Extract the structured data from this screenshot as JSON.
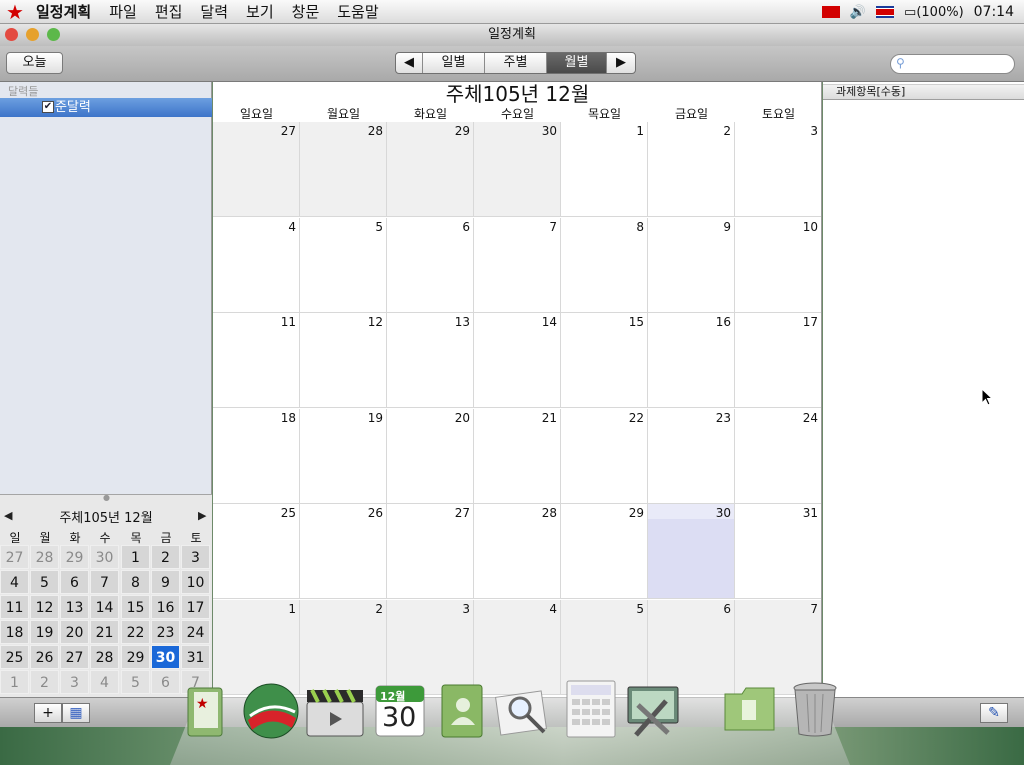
{
  "menubar": {
    "app_name": "일정계획",
    "items": [
      "파일",
      "편집",
      "달력",
      "보기",
      "창문",
      "도움말"
    ],
    "battery": "(100%)",
    "clock": "07:14"
  },
  "window": {
    "title": "일정계획"
  },
  "toolbar": {
    "today_label": "오늘",
    "views": [
      "일별",
      "주별",
      "월별"
    ],
    "active_view": "월별",
    "search_value": ""
  },
  "sidebar": {
    "heading": "달력들",
    "calendars": [
      {
        "label": "표준달력",
        "checked": true
      }
    ]
  },
  "mini_calendar": {
    "title": "주체105년 12월",
    "weekdays": [
      "일",
      "월",
      "화",
      "수",
      "목",
      "금",
      "토"
    ],
    "weeks": [
      [
        "27",
        "28",
        "29",
        "30",
        "1",
        "2",
        "3"
      ],
      [
        "4",
        "5",
        "6",
        "7",
        "8",
        "9",
        "10"
      ],
      [
        "11",
        "12",
        "13",
        "14",
        "15",
        "16",
        "17"
      ],
      [
        "18",
        "19",
        "20",
        "21",
        "22",
        "23",
        "24"
      ],
      [
        "25",
        "26",
        "27",
        "28",
        "29",
        "30",
        "31"
      ],
      [
        "1",
        "2",
        "3",
        "4",
        "5",
        "6",
        "7"
      ]
    ],
    "selected": "30"
  },
  "month_view": {
    "title": "주체105년 12월",
    "weekdays": [
      "일요일",
      "월요일",
      "화요일",
      "수요일",
      "목요일",
      "금요일",
      "토요일"
    ],
    "weeks": [
      [
        "27",
        "28",
        "29",
        "30",
        "1",
        "2",
        "3"
      ],
      [
        "4",
        "5",
        "6",
        "7",
        "8",
        "9",
        "10"
      ],
      [
        "11",
        "12",
        "13",
        "14",
        "15",
        "16",
        "17"
      ],
      [
        "18",
        "19",
        "20",
        "21",
        "22",
        "23",
        "24"
      ],
      [
        "25",
        "26",
        "27",
        "28",
        "29",
        "30",
        "31"
      ],
      [
        "1",
        "2",
        "3",
        "4",
        "5",
        "6",
        "7"
      ]
    ],
    "today": "30"
  },
  "tasks": {
    "header": "과제항목[수동]"
  },
  "dock": {
    "calendar_icon_month": "12월",
    "calendar_icon_day": "30",
    "items": [
      "notes-app-icon",
      "browser-globe-icon",
      "video-clapper-icon",
      "calendar-app-icon",
      "address-book-icon",
      "preview-magnifier-icon",
      "calculator-icon",
      "system-preferences-icon",
      "documents-folder-icon",
      "trash-icon"
    ]
  },
  "colors": {
    "selection": "#1a68d8",
    "today_cell": "#dcddf3",
    "star": "#d20000"
  }
}
